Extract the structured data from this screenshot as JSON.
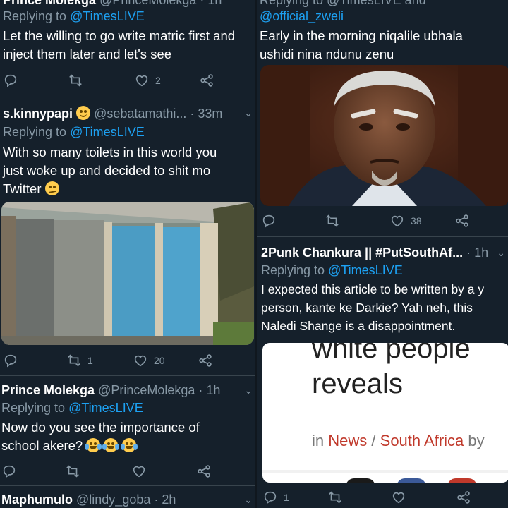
{
  "left": {
    "t1": {
      "name": "Prince Molekga",
      "handle": "@PrinceMolekga · 1h",
      "replying": "Replying to",
      "mention": "@TimesLIVE",
      "text": "Let the willing to go write matric first and inject them later and let's see",
      "likes": "2"
    },
    "t2": {
      "name": "s.kinnypapi",
      "handle": "@sebatamathi... · 33m",
      "replying": "Replying to",
      "mention": "@TimesLIVE",
      "text": "With so many toilets in this world you just woke up and decided to shit mo Twitter",
      "retweets": "1",
      "likes": "20"
    },
    "t3": {
      "name": "Prince Molekga",
      "handle": "@PrinceMolekga · 1h",
      "replying": "Replying to",
      "mention": "@TimesLIVE",
      "text": "Now do you see the importance of school akere?"
    },
    "t4": {
      "name": "Maphumulo",
      "handle": "@lindy_goba · 2h"
    }
  },
  "right": {
    "t1": {
      "replying": "Replying to @TimesLIVE and",
      "mention": "@official_zweli",
      "text": "Early in the morning niqalile ubhala ushidi nina ndunu zenu",
      "likes": "38"
    },
    "t2": {
      "name": "2Punk Chankura || #PutSouthAf...",
      "time": "· 1h",
      "replying": "Replying to",
      "mention": "@TimesLIVE",
      "text": "I expected this article to be written by a y person, kante ke Darkie? Yah neh, this Naledi Shange is a disappointment.",
      "card_headline_top": "white people",
      "card_headline": "reveals",
      "card_meta_in": "in",
      "card_meta_news": "News",
      "card_meta_slash": "/",
      "card_meta_sa": "South Africa",
      "card_meta_by": "by",
      "reply_count": "1"
    }
  },
  "icons": {
    "reply": "reply-icon",
    "retweet": "retweet-icon",
    "like": "heart-icon",
    "share": "share-icon",
    "chevron": "chevron-down-icon"
  },
  "colors": {
    "background": "#15202b",
    "accent": "#1da1f2",
    "muted": "#8899a6",
    "divider": "#38444d"
  }
}
